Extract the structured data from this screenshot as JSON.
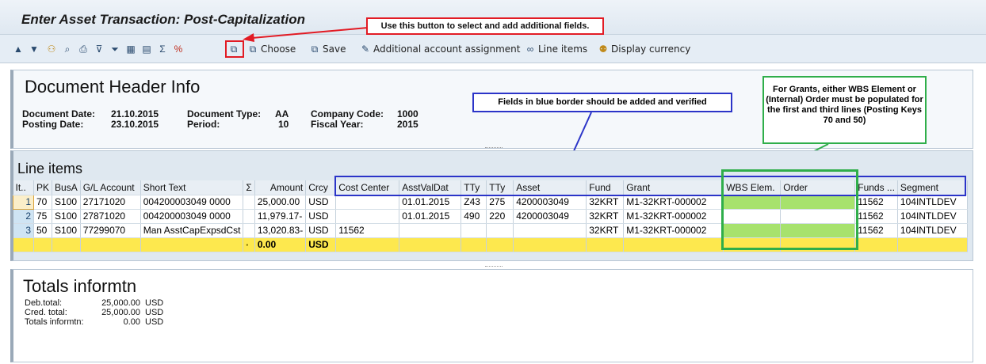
{
  "title": "Enter Asset Transaction: Post-Capitalization",
  "callouts": {
    "add_fields": "Use this button to select and add additional fields.",
    "blue_border": "Fields in blue border should be added and verified",
    "grants": "For Grants, either WBS Element or (Internal) Order must be populated for the first and third lines (Posting Keys 70 and 50)"
  },
  "toolbar": {
    "choose": "Choose",
    "save": "Save",
    "additional_account": "Additional account assignment",
    "line_items": "Line items",
    "display_currency": "Display currency"
  },
  "header": {
    "title": "Document Header Info",
    "document_date_label": "Document Date:",
    "document_date": "21.10.2015",
    "posting_date_label": "Posting Date:",
    "posting_date": "23.10.2015",
    "document_type_label": "Document Type:",
    "document_type": "AA",
    "period_label": "Period:",
    "period": "10",
    "company_code_label": "Company Code:",
    "company_code": "1000",
    "fiscal_year_label": "Fiscal Year:",
    "fiscal_year": "2015"
  },
  "line_items": {
    "title": "Line items",
    "columns": [
      "It..",
      "PK",
      "BusA",
      "G/L Account",
      "Short Text",
      "Σ",
      "Amount",
      "Crcy",
      "Cost Center",
      "AsstValDat",
      "TTy",
      "TTy",
      "Asset",
      "Fund",
      "Grant",
      "WBS Elem.",
      "Order",
      "Funds ...",
      "Segment"
    ],
    "rows": [
      {
        "item": "1",
        "pk": "70",
        "busa": "S100",
        "gl": "27171020",
        "text": "004200003049 0000",
        "amount": "25,000.00",
        "crcy": "USD",
        "cost_center": "",
        "asst_val_dat": "01.01.2015",
        "tty1": "Z43",
        "tty2": "275",
        "asset": "4200003049",
        "fund": "32KRT",
        "grant": "M1-32KRT-000002",
        "wbs": "",
        "order": "",
        "funds": "11562",
        "segment": "104INTLDEV"
      },
      {
        "item": "2",
        "pk": "75",
        "busa": "S100",
        "gl": "27871020",
        "text": "004200003049 0000",
        "amount": "11,979.17-",
        "crcy": "USD",
        "cost_center": "",
        "asst_val_dat": "01.01.2015",
        "tty1": "490",
        "tty2": "220",
        "asset": "4200003049",
        "fund": "32KRT",
        "grant": "M1-32KRT-000002",
        "wbs": "",
        "order": "",
        "funds": "11562",
        "segment": "104INTLDEV"
      },
      {
        "item": "3",
        "pk": "50",
        "busa": "S100",
        "gl": "77299070",
        "text": "Man AsstCapExpsdCst",
        "amount": "13,020.83-",
        "crcy": "USD",
        "cost_center": "11562",
        "asst_val_dat": "",
        "tty1": "",
        "tty2": "",
        "asset": "",
        "fund": "32KRT",
        "grant": "M1-32KRT-000002",
        "wbs": "",
        "order": "",
        "funds": "11562",
        "segment": "104INTLDEV"
      }
    ],
    "total_marker": "▪",
    "total_amount": "0.00",
    "total_crcy": "USD"
  },
  "totals": {
    "title": "Totals informtn",
    "deb_label": "Deb.total:",
    "deb_value": "25,000.00",
    "deb_crcy": "USD",
    "cred_label": "Cred. total:",
    "cred_value": "25,000.00",
    "cred_crcy": "USD",
    "info_label": "Totals informtn:",
    "info_value": "0.00",
    "info_crcy": "USD"
  }
}
